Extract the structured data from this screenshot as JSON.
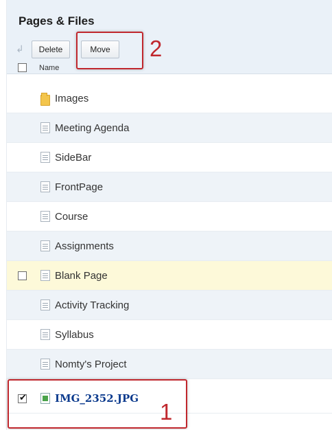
{
  "header": {
    "title": "Pages & Files"
  },
  "toolbar": {
    "delete_label": "Delete",
    "move_label": "Move"
  },
  "table": {
    "column_name": "Name",
    "rows": [
      {
        "label": "Images",
        "icon": "folder-icon",
        "checked": false
      },
      {
        "label": "Meeting Agenda",
        "icon": "page-icon",
        "checked": false
      },
      {
        "label": "SideBar",
        "icon": "page-icon",
        "checked": false
      },
      {
        "label": "FrontPage",
        "icon": "page-icon",
        "checked": false
      },
      {
        "label": "Course",
        "icon": "page-icon",
        "checked": false
      },
      {
        "label": "Assignments",
        "icon": "page-icon",
        "checked": false
      },
      {
        "label": "Blank Page",
        "icon": "page-icon",
        "checked": false
      },
      {
        "label": "Activity Tracking",
        "icon": "page-icon",
        "checked": false
      },
      {
        "label": "Syllabus",
        "icon": "page-icon",
        "checked": false
      },
      {
        "label": "Nomty's Project",
        "icon": "page-icon",
        "checked": false
      },
      {
        "label": "IMG_2352.JPG",
        "icon": "image-file-icon",
        "checked": true
      }
    ]
  },
  "callouts": {
    "step_one": "1",
    "step_two": "2"
  },
  "colors": {
    "callout_red": "#c0272d",
    "highlight_row": "#fdf9d9",
    "header_bg": "#eaf1f8"
  }
}
